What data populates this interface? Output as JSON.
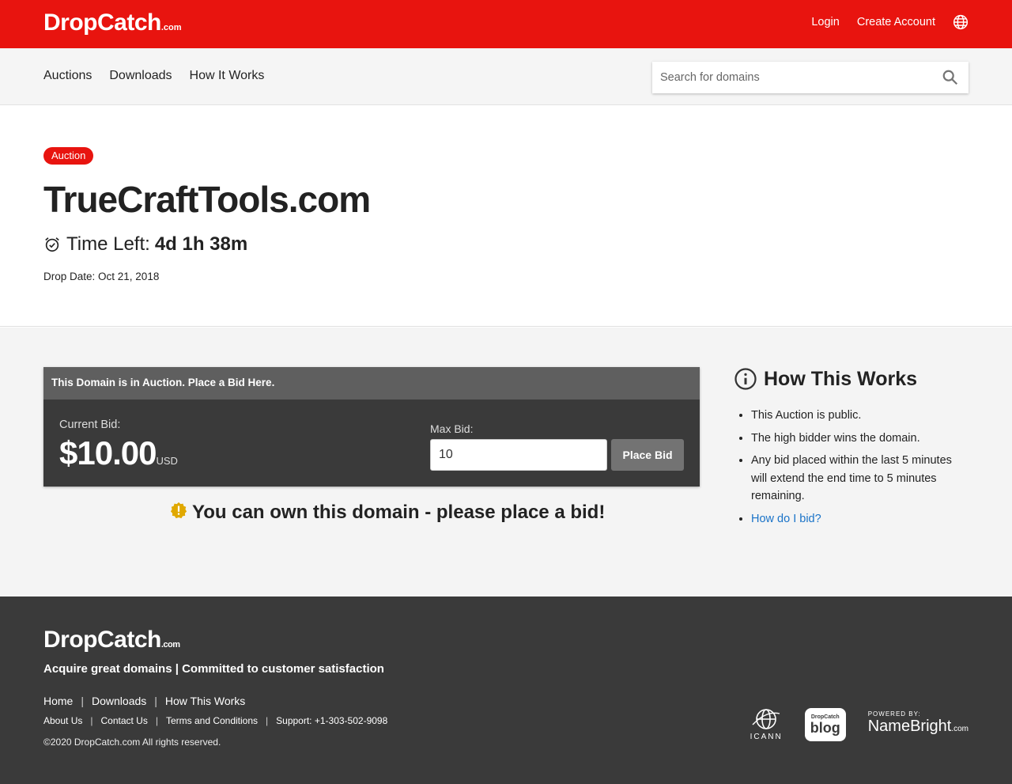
{
  "brand": {
    "logo_main": "DropCatch",
    "logo_tld": ".com"
  },
  "topbar": {
    "login": "Login",
    "create_account": "Create Account",
    "language_icon": "globe-icon"
  },
  "nav": {
    "items": [
      {
        "label": "Auctions"
      },
      {
        "label": "Downloads"
      },
      {
        "label": "How It Works"
      }
    ],
    "search_placeholder": "Search for domains",
    "search_icon": "search-icon"
  },
  "listing": {
    "badge": "Auction",
    "domain": "TrueCraftTools.com",
    "time_left_label": "Time Left:",
    "time_left_value": "4d 1h 38m",
    "drop_date": "Drop Date: Oct 21, 2018"
  },
  "bid": {
    "header": "This Domain is in Auction. Place a Bid Here.",
    "current_bid_label": "Current Bid:",
    "current_bid_value": "$10.00",
    "currency": "USD",
    "max_bid_label": "Max Bid:",
    "max_bid_value": "10",
    "place_bid_label": "Place Bid",
    "own_message": "You can own this domain - please place a bid!"
  },
  "how_it_works": {
    "title": "How This Works",
    "items": [
      "This Auction is public.",
      "The high bidder wins the domain.",
      "Any bid placed within the last 5 minutes will extend the end time to 5 minutes remaining."
    ],
    "link": "How do I bid?"
  },
  "footer": {
    "tagline": "Acquire great domains | Committed to customer satisfaction",
    "primary_links": [
      "Home",
      "Downloads",
      "How This Works"
    ],
    "secondary_links": [
      "About Us",
      "Contact Us",
      "Terms and Conditions",
      "Support: +1-303-502-9098"
    ],
    "copyright": "©2020 DropCatch.com All rights reserved.",
    "badges": {
      "icann": "ICANN",
      "blog_small": "DropCatch",
      "blog_big": "blog",
      "powered_by": "POWERED BY:",
      "namebright": "NameBright",
      "namebright_tld": ".com"
    }
  },
  "colors": {
    "brand_red": "#e8140f",
    "dark_panel": "#3a3a3a",
    "link_blue": "#1a73c8",
    "warning_yellow": "#e0a800"
  }
}
